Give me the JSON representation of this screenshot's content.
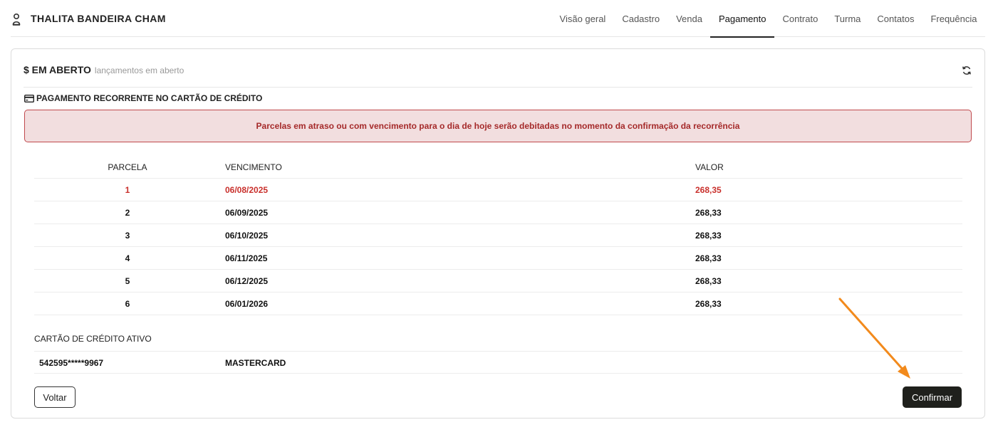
{
  "header": {
    "user_name": "THALITA BANDEIRA CHAM",
    "tabs": [
      {
        "label": "Visão geral"
      },
      {
        "label": "Cadastro"
      },
      {
        "label": "Venda"
      },
      {
        "label": "Pagamento",
        "active": true
      },
      {
        "label": "Contrato"
      },
      {
        "label": "Turma"
      },
      {
        "label": "Contatos"
      },
      {
        "label": "Frequência"
      }
    ]
  },
  "card": {
    "title": "$ EM ABERTO",
    "subtitle": "lançamentos em aberto",
    "section_title": "PAGAMENTO RECORRENTE NO CARTÃO DE CRÉDITO",
    "alert": "Parcelas em atraso ou com vencimento para o dia de hoje serão debitadas no momento da confirmação da recorrência"
  },
  "table": {
    "columns": [
      "PARCELA",
      "VENCIMENTO",
      "VALOR"
    ],
    "rows": [
      {
        "parcela": "1",
        "vencimento": "06/08/2025",
        "valor": "268,35",
        "overdue": true
      },
      {
        "parcela": "2",
        "vencimento": "06/09/2025",
        "valor": "268,33"
      },
      {
        "parcela": "3",
        "vencimento": "06/10/2025",
        "valor": "268,33"
      },
      {
        "parcela": "4",
        "vencimento": "06/11/2025",
        "valor": "268,33"
      },
      {
        "parcela": "5",
        "vencimento": "06/12/2025",
        "valor": "268,33"
      },
      {
        "parcela": "6",
        "vencimento": "06/01/2026",
        "valor": "268,33"
      }
    ]
  },
  "credit_card": {
    "label": "CARTÃO DE CRÉDITO ATIVO",
    "number": "542595*****9967",
    "brand": "MASTERCARD"
  },
  "buttons": {
    "back": "Voltar",
    "confirm": "Confirmar"
  },
  "colors": {
    "overdue": "#c9302c",
    "alert_bg": "#f2dedf",
    "alert_border": "#c0494d",
    "confirm_bg": "#1f201c",
    "annotation_arrow": "#f28a1c"
  },
  "icons": {
    "user": "user-icon",
    "refresh": "refresh-icon",
    "card": "credit-card-icon",
    "annotation": "arrow-annotation"
  }
}
